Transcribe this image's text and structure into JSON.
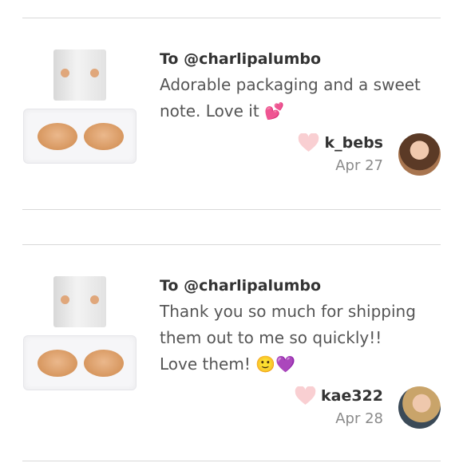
{
  "reviews": [
    {
      "to": "To @charlipalumbo",
      "message": "Adorable packaging and a sweet note. Love it 💕",
      "username": "k_bebs",
      "date": "Apr 27"
    },
    {
      "to": "To @charlipalumbo",
      "message": "Thank you so much for shipping them out to me so quickly!! Love them! 🙂💜",
      "username": "kae322",
      "date": "Apr 28"
    }
  ],
  "icons": {
    "like": "heart-icon",
    "avatar": "user-avatar"
  },
  "colors": {
    "heart": "#f9cfd2",
    "divider": "#d9d9d9",
    "date": "#8a8a8a"
  }
}
